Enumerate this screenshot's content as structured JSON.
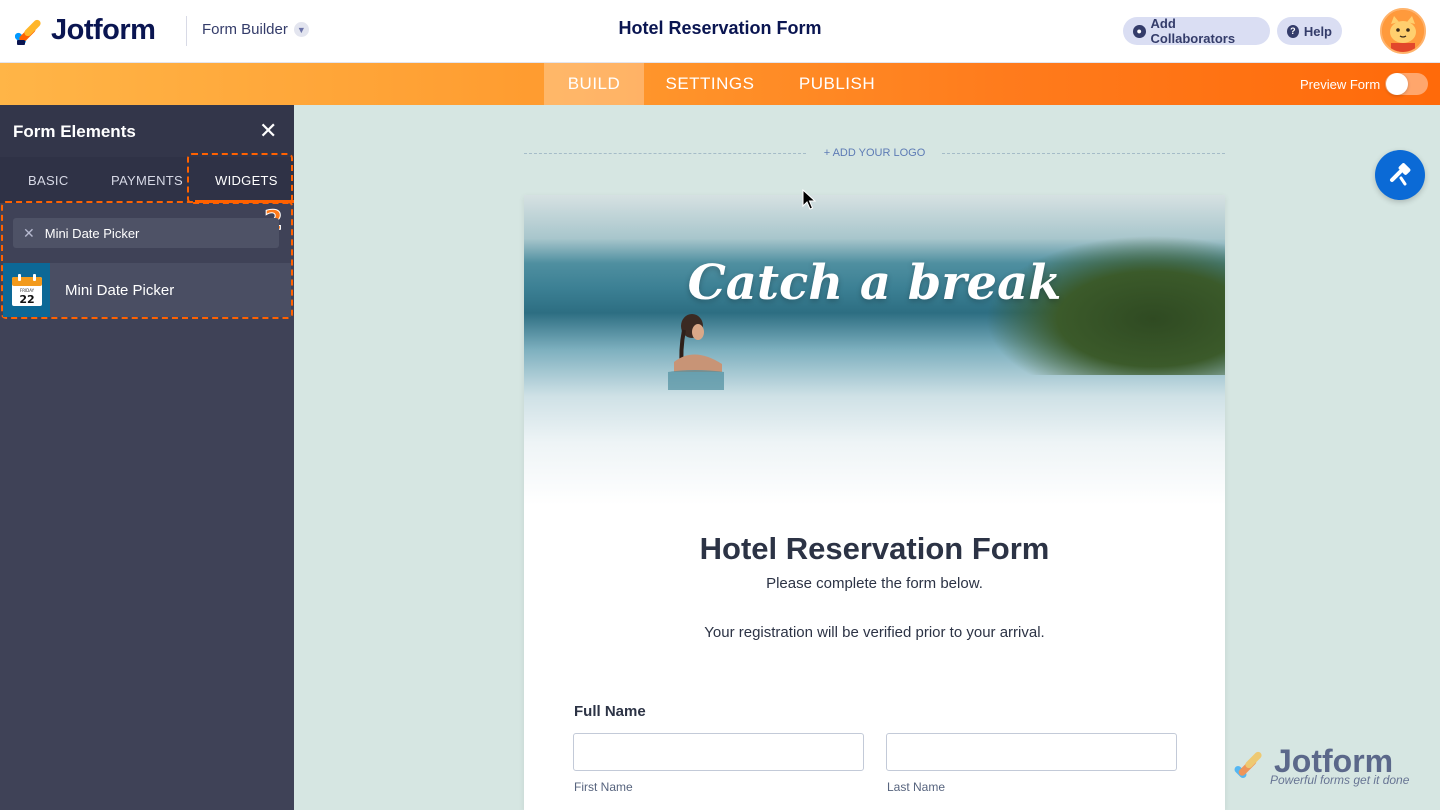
{
  "header": {
    "brand": "Jotform",
    "builder_label": "Form Builder",
    "form_title": "Hotel Reservation Form",
    "add_collaborators": "Add Collaborators",
    "help": "Help"
  },
  "nav": {
    "tabs": [
      {
        "label": "BUILD",
        "active": true
      },
      {
        "label": "SETTINGS",
        "active": false
      },
      {
        "label": "PUBLISH",
        "active": false
      }
    ],
    "preview_label": "Preview Form",
    "preview_on": false
  },
  "sidebar": {
    "title": "Form Elements",
    "tabs": [
      {
        "label": "BASIC"
      },
      {
        "label": "PAYMENTS"
      },
      {
        "label": "WIDGETS",
        "active": true
      }
    ],
    "step_badge": "2",
    "search_value": "Mini Date Picker",
    "results": [
      {
        "label": "Mini Date Picker",
        "icon": "calendar-icon",
        "icon_day": "FRIDAY",
        "icon_date": "22"
      }
    ]
  },
  "canvas": {
    "add_logo": "+ ADD YOUR LOGO",
    "hero_text": "Catch a break",
    "form": {
      "title": "Hotel Reservation Form",
      "subtitle": "Please complete the form below.",
      "note": "Your registration will be verified prior to your arrival.",
      "fields": [
        {
          "label": "Full Name",
          "sublabels": [
            "First Name",
            "Last Name"
          ]
        }
      ]
    }
  },
  "watermark": {
    "name": "Jotform",
    "tagline": "Powerful forms get it done"
  },
  "colors": {
    "accent": "#ff6100",
    "nav_gradient_start": "#ffb547",
    "nav_gradient_end": "#ff6a0a",
    "sidebar_bg": "#3f4257",
    "canvas_bg": "#d6e6e2",
    "designer_button": "#0b6ad6"
  }
}
